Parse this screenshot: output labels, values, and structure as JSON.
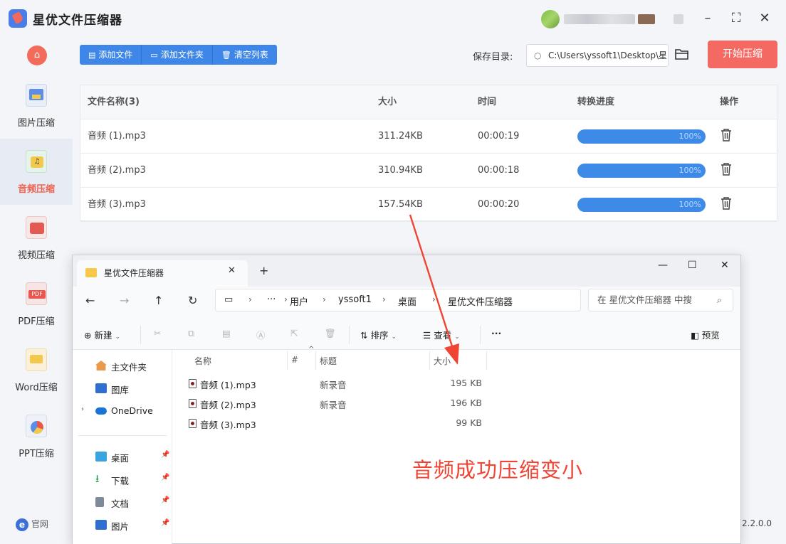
{
  "app": {
    "title": "星优文件压缩器"
  },
  "sidebar": {
    "items": [
      {
        "label": "图片压缩",
        "icon": "image-compress-icon"
      },
      {
        "label": "音频压缩",
        "icon": "audio-compress-icon",
        "active": true
      },
      {
        "label": "视频压缩",
        "icon": "video-compress-icon"
      },
      {
        "label": "PDF压缩",
        "icon": "pdf-compress-icon"
      },
      {
        "label": "Word压缩",
        "icon": "word-compress-icon"
      },
      {
        "label": "PPT压缩",
        "icon": "ppt-compress-icon"
      }
    ],
    "footer_label": "官网"
  },
  "toolbar": {
    "add_file": "添加文件",
    "add_folder": "添加文件夹",
    "clear_list": "清空列表",
    "save_dir_label": "保存目录:",
    "save_dir_value": "C:\\Users\\yssoft1\\Desktop\\星",
    "start_button": "开始压缩"
  },
  "table": {
    "headers": [
      "文件名称(3)",
      "大小",
      "时间",
      "转换进度",
      "操作"
    ],
    "rows": [
      {
        "name": "音频 (1).mp3",
        "size": "311.24KB",
        "time": "00:00:19",
        "progress": "100%"
      },
      {
        "name": "音频 (2).mp3",
        "size": "310.94KB",
        "time": "00:00:18",
        "progress": "100%"
      },
      {
        "name": "音频 (3).mp3",
        "size": "157.54KB",
        "time": "00:00:20",
        "progress": "100%"
      }
    ]
  },
  "version": "2.2.0.0",
  "explorer": {
    "tab_title": "星优文件压缩器",
    "breadcrumb": [
      "用户",
      "yssoft1",
      "桌面",
      "星优文件压缩器"
    ],
    "search_placeholder": "在 星优文件压缩器 中搜",
    "commands": {
      "new": "新建",
      "sort": "排序",
      "view": "查看",
      "preview": "预览"
    },
    "nav_items": [
      {
        "label": "主文件夹"
      },
      {
        "label": "图库"
      },
      {
        "label": "OneDrive"
      },
      {
        "label": "桌面",
        "pinned": true
      },
      {
        "label": "下载",
        "pinned": true
      },
      {
        "label": "文档",
        "pinned": true
      },
      {
        "label": "图片",
        "pinned": true
      }
    ],
    "columns": [
      "名称",
      "#",
      "标题",
      "大小"
    ],
    "files": [
      {
        "name": "音频 (1).mp3",
        "title": "新录音",
        "size": "195 KB"
      },
      {
        "name": "音频 (2).mp3",
        "title": "新录音",
        "size": "196 KB"
      },
      {
        "name": "音频 (3).mp3",
        "title": "",
        "size": "99 KB"
      }
    ]
  },
  "annotation": "音频成功压缩变小",
  "colors": {
    "accent_blue": "#3e87e8",
    "accent_red": "#f46a63",
    "annotation_red": "#f04434"
  }
}
